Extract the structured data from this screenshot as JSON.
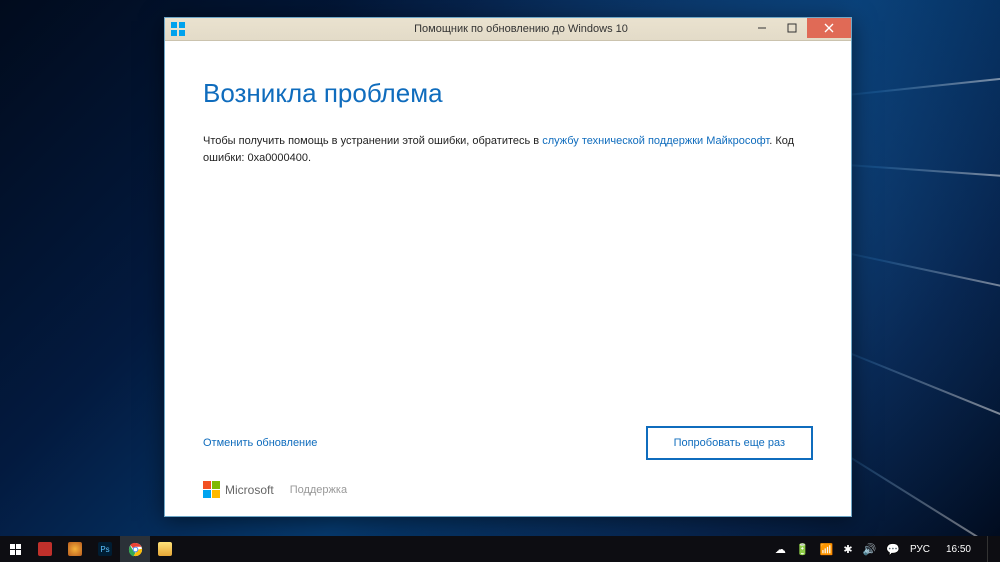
{
  "window": {
    "title": "Помощник по обновлению до Windows 10",
    "heading": "Возникла проблема",
    "body_prefix": "Чтобы получить помощь в устранении этой ошибки, обратитесь в ",
    "body_link": "службу технической поддержки Майкрософт",
    "body_suffix": ". Код ошибки: 0xa0000400.",
    "cancel": "Отменить обновление",
    "retry": "Попробовать еще раз",
    "ms": "Microsoft",
    "support": "Поддержка"
  },
  "taskbar": {
    "lang": "РУС",
    "clock": "16:50",
    "icons": {
      "start": "start-icon",
      "pinned": [
        "app1",
        "paint",
        "photoshop",
        "chrome",
        "explorer"
      ]
    }
  }
}
